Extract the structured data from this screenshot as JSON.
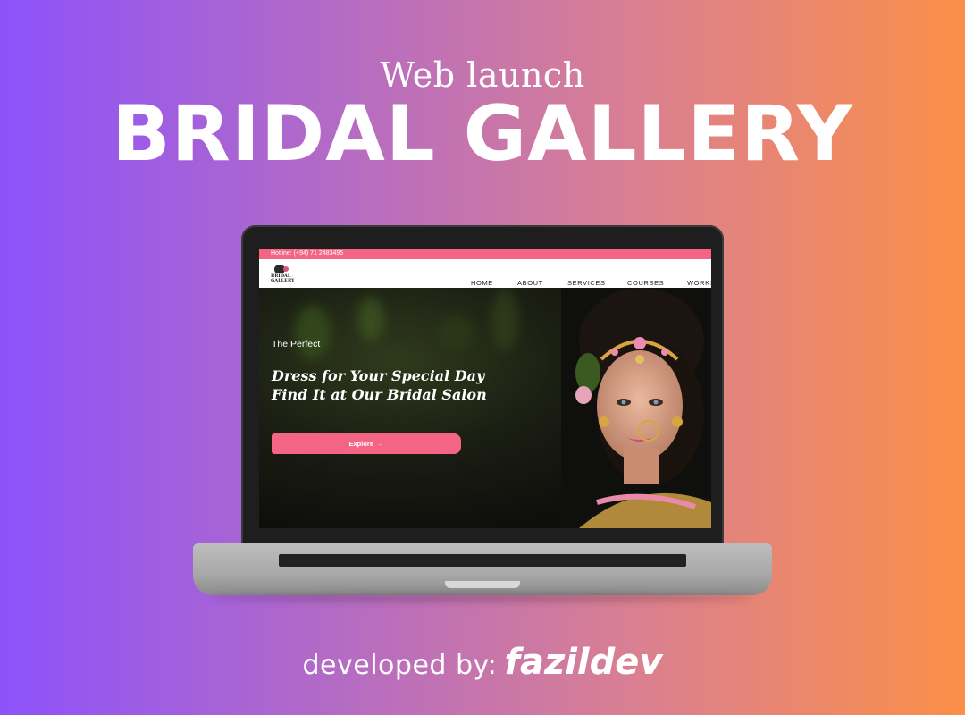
{
  "headline": {
    "sub": "Web launch",
    "main": "BRIDAL GALLERY"
  },
  "website": {
    "hotline": "Hotline: (+94) 71 2483495",
    "logo_text": "BRIDAL\nGALLERY",
    "nav": [
      "HOME",
      "ABOUT",
      "SERVICES",
      "COURSES",
      "WORKS"
    ],
    "hero": {
      "kicker": "The Perfect",
      "title_line1": "Dress for Your Special Day",
      "title_line2": "Find It at Our Bridal Salon",
      "cta_label": "Explore",
      "cta_icon": "arrow-right-icon"
    },
    "colors": {
      "accent": "#f46485"
    }
  },
  "footer": {
    "prefix": "developed by:",
    "brand": "fazildev"
  },
  "colors": {
    "gradient_start": "#8d52fb",
    "gradient_end": "#fb8f48"
  }
}
